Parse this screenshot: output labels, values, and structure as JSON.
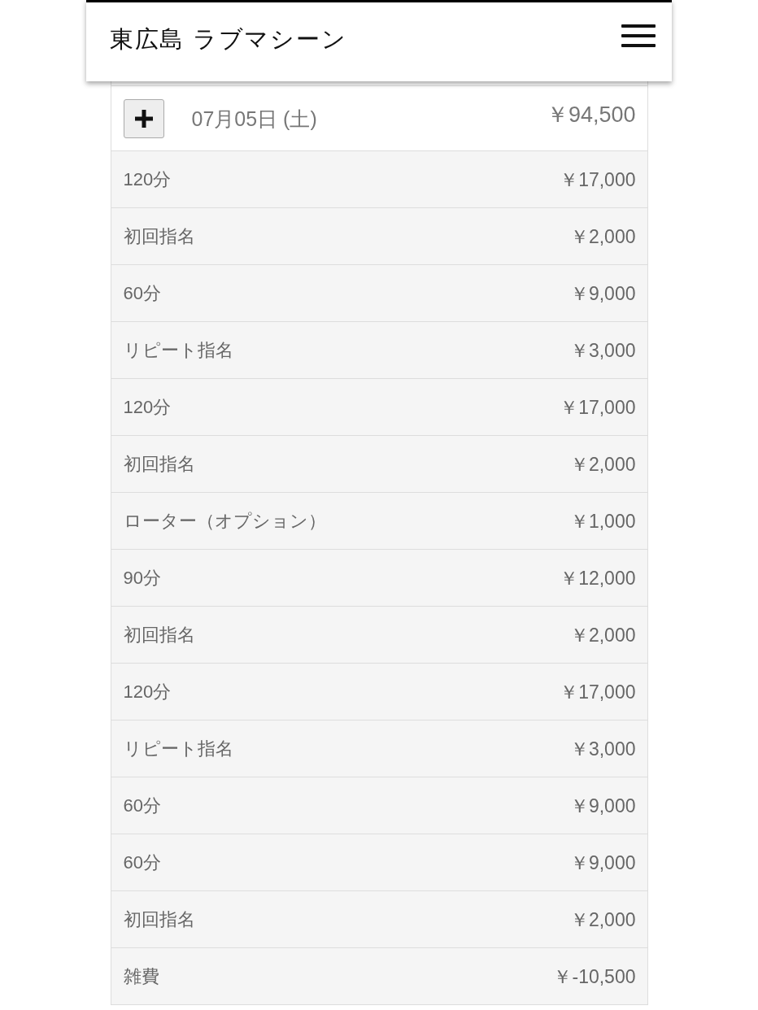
{
  "header": {
    "title": "東広島 ラブマシーン"
  },
  "day": {
    "date": "07月05日 (土)",
    "total": "￥94,500"
  },
  "items": [
    {
      "name": "120分",
      "price": "￥17,000"
    },
    {
      "name": "初回指名",
      "price": "￥2,000"
    },
    {
      "name": "60分",
      "price": "￥9,000"
    },
    {
      "name": "リピート指名",
      "price": "￥3,000"
    },
    {
      "name": "120分",
      "price": "￥17,000"
    },
    {
      "name": "初回指名",
      "price": "￥2,000"
    },
    {
      "name": "ローター（オプション）",
      "price": "￥1,000"
    },
    {
      "name": "90分",
      "price": "￥12,000"
    },
    {
      "name": "初回指名",
      "price": "￥2,000"
    },
    {
      "name": "120分",
      "price": "￥17,000"
    },
    {
      "name": "リピート指名",
      "price": "￥3,000"
    },
    {
      "name": "60分",
      "price": "￥9,000"
    },
    {
      "name": "60分",
      "price": "￥9,000"
    },
    {
      "name": "初回指名",
      "price": "￥2,000"
    },
    {
      "name": "雑費",
      "price": "￥-10,500"
    }
  ]
}
